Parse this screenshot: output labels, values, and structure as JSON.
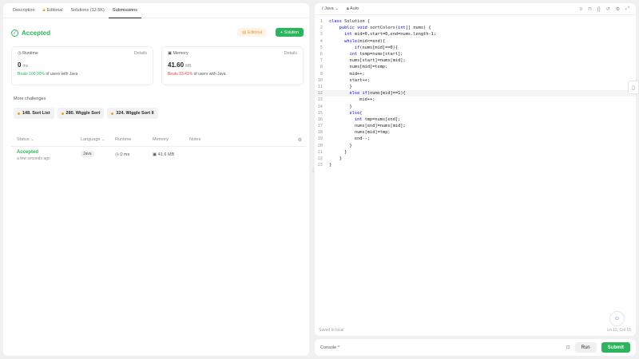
{
  "left_tabs": [
    {
      "label": "Description"
    },
    {
      "label": "Editorial",
      "locked": true
    },
    {
      "label": "Solutions (12.5K)"
    },
    {
      "label": "Submissions",
      "active": true
    }
  ],
  "result": {
    "status": "Accepted",
    "editorial_label": "Editorial",
    "solution_label": "Solution"
  },
  "runtime": {
    "label": "Runtime",
    "details": "Details",
    "value": "0",
    "unit": "ms",
    "beats_pct": "Beats 100.00%",
    "beats_rest": "of users with Java"
  },
  "memory": {
    "label": "Memory",
    "details": "Details",
    "value": "41.60",
    "unit": "MB",
    "beats_pct": "Beats 23.41%",
    "beats_rest": "of users with Java"
  },
  "more_challenges": {
    "label": "More challenges",
    "items": [
      "148. Sort List",
      "280. Wiggle Sort",
      "324. Wiggle Sort II"
    ]
  },
  "submissions_table": {
    "headers": {
      "status": "Status",
      "language": "Language",
      "runtime": "Runtime",
      "memory": "Memory",
      "notes": "Notes"
    },
    "rows": [
      {
        "status": "Accepted",
        "time": "a few seconds ago",
        "language": "Java",
        "runtime": "0 ms",
        "memory": "41.6 MB"
      }
    ]
  },
  "editor": {
    "language": "Java",
    "mode": "Auto",
    "saved_text": "Saved to local",
    "cursor_pos": "Ln 12, Col 15",
    "code_lines": [
      "class Solution {",
      "    public void sortColors(int[] nums) {",
      "      int mid=0,start=0,end=nums.length-1;",
      "      while(mid<=end){",
      "          if(nums[mid]==0){",
      "        int temp=nums[start];",
      "        nums[start]=nums[mid];",
      "        nums[mid]=temp;",
      "        mid++;",
      "        start++;",
      "        }",
      "        else if(nums[mid]==1){",
      "            mid++;",
      "        }",
      "        else{",
      "          int tmp=nums[end];",
      "          nums[end]=nums[mid];",
      "          nums[mid]=tmp;",
      "          end--;",
      "        }",
      "      }",
      "    }",
      "}"
    ]
  },
  "console": {
    "label": "Console",
    "run_label": "Run",
    "submit_label": "Submit"
  },
  "colors": {
    "accent_green": "#2db55d",
    "beats_red": "#e0463f",
    "editorial_orange": "#e8923a"
  }
}
